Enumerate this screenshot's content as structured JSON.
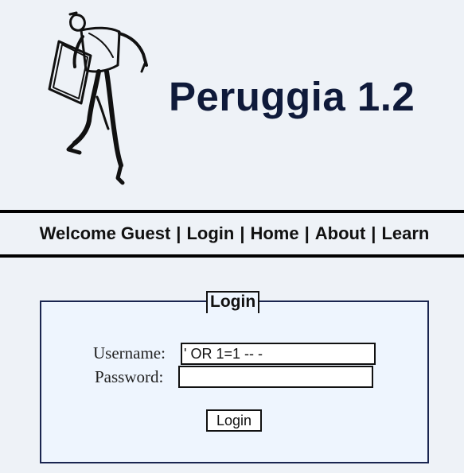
{
  "header": {
    "logo_icon": "running-man-sketch-icon",
    "title": "Peruggia 1.2"
  },
  "nav": {
    "welcome": "Welcome Guest",
    "separator": "|",
    "links": [
      "Login",
      "Home",
      "About",
      "Learn"
    ]
  },
  "login": {
    "legend": "Login",
    "username_label": "Username:",
    "username_value": "' OR 1=1 -- -",
    "password_label": "Password:",
    "password_value": "",
    "submit_label": "Login"
  },
  "colors": {
    "background": "#eef2f7",
    "title": "#0f1a3a",
    "box_background": "#eef5fe",
    "box_border": "#1a2550"
  }
}
